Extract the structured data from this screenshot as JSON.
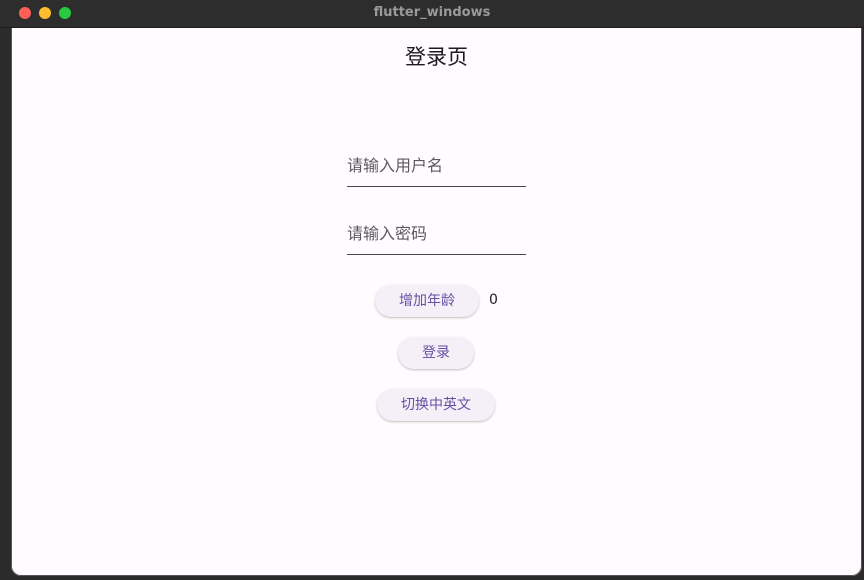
{
  "window": {
    "title": "flutter_windows"
  },
  "page": {
    "title": "登录页"
  },
  "form": {
    "username_placeholder": "请输入用户名",
    "password_placeholder": "请输入密码"
  },
  "buttons": {
    "increase_age": "增加年龄",
    "login": "登录",
    "switch_language": "切换中英文"
  },
  "age": {
    "value": "0"
  },
  "colors": {
    "accent": "#6750a4",
    "button_bg": "#f5eff7",
    "background": "#fffbfe",
    "titlebar": "#2d2d2d"
  },
  "icons": {
    "close": "close-traffic-light-icon",
    "minimize": "minimize-traffic-light-icon",
    "maximize": "maximize-traffic-light-icon"
  }
}
